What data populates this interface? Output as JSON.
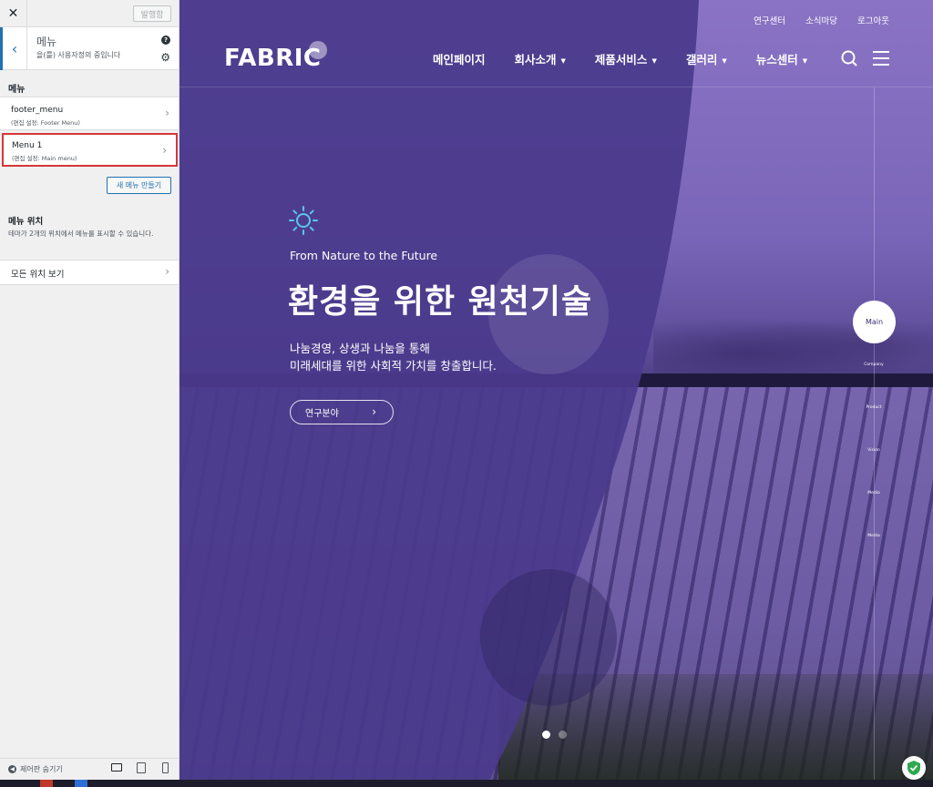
{
  "sidebar": {
    "close_glyph": "✕",
    "publish_label": "발행함",
    "header": {
      "title": "메뉴",
      "subtitle": "을(를) 사용자정의 중입니다"
    },
    "menus_section_title": "메뉴",
    "menus": [
      {
        "name": "footer_menu",
        "location": "(편집 설정: Footer Menu)"
      },
      {
        "name": "Menu 1",
        "location": "(편집 설정: Main menu)"
      }
    ],
    "new_menu_button": "새 메뉴 만들기",
    "locations_title": "메뉴 위치",
    "locations_desc": "테마가 2개의 위치에서 메뉴를 표시할 수 있습니다.",
    "view_all_locations": "모든 위치 보기",
    "hide_controls": "제어판 숨기기",
    "highlight_color": "#d63638",
    "accent_color": "#2271b1"
  },
  "site": {
    "top_links": [
      "연구센터",
      "소식마당",
      "로그아웃"
    ],
    "logo": "FABRIC",
    "nav": [
      {
        "label": "메인페이지",
        "has_dropdown": false
      },
      {
        "label": "회사소개",
        "has_dropdown": true
      },
      {
        "label": "제품서비스",
        "has_dropdown": true
      },
      {
        "label": "갤러리",
        "has_dropdown": true
      },
      {
        "label": "뉴스센터",
        "has_dropdown": true
      }
    ],
    "hero": {
      "tagline": "From Nature to the Future",
      "title": "환경을 위한 원천기술",
      "desc_line1": "나눔경영, 상생과 나눔을 통해",
      "desc_line2": "미래세대를 위한 사회적 가치를 창출합니다.",
      "button": "연구분야"
    },
    "side_nav": [
      "Main",
      "Company",
      "Product",
      "Vision",
      "Media",
      "Media"
    ],
    "slides_total": 2,
    "slide_active": 1,
    "overlay_color": "#4a3a8c",
    "icon_color": "#5bc8e8"
  }
}
